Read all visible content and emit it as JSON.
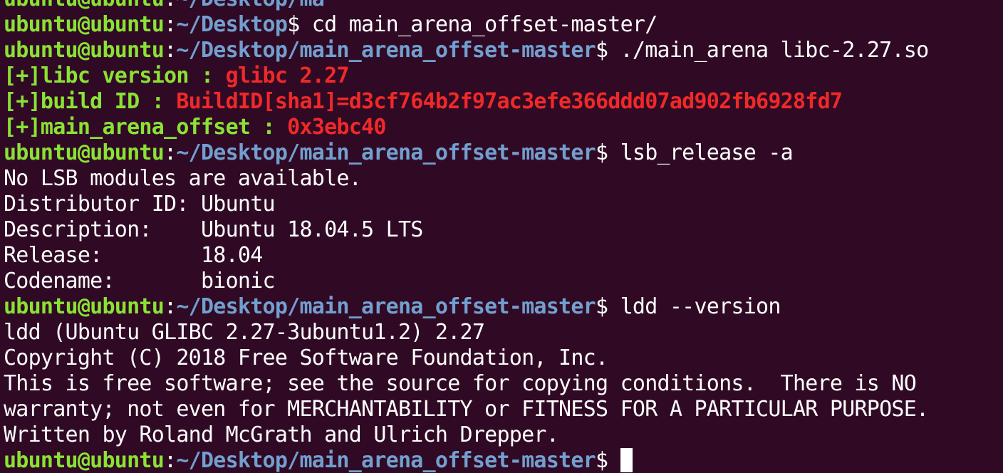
{
  "prompt": {
    "user_host": "ubuntu@ubuntu",
    "colon": ":",
    "dollar": "$"
  },
  "lines": {
    "l0": {
      "path": "~/Desktop/ma",
      "cmd": ""
    },
    "l1": {
      "path": "~/Desktop",
      "cmd": " cd main_arena_offset-master/"
    },
    "l2": {
      "path": "~/Desktop/main_arena_offset-master",
      "cmd": " ./main_arena libc-2.27.so"
    },
    "l3": {
      "label": "[+]libc version : ",
      "value": "glibc 2.27"
    },
    "l4": {
      "label": "[+]build ID : ",
      "value": "BuildID[sha1]=d3cf764b2f97ac3efe366ddd07ad902fb6928fd7"
    },
    "l5": {
      "label": "[+]main_arena_offset : ",
      "value": "0x3ebc40"
    },
    "l6": {
      "path": "~/Desktop/main_arena_offset-master",
      "cmd": " lsb_release -a"
    },
    "l7": "No LSB modules are available.",
    "l8": "Distributor ID:\tUbuntu",
    "l9": "Description:\tUbuntu 18.04.5 LTS",
    "l10": "Release:\t18.04",
    "l11": "Codename:\tbionic",
    "l12": {
      "path": "~/Desktop/main_arena_offset-master",
      "cmd": " ldd --version"
    },
    "l13": "ldd (Ubuntu GLIBC 2.27-3ubuntu1.2) 2.27",
    "l14": "Copyright (C) 2018 Free Software Foundation, Inc.",
    "l15": "This is free software; see the source for copying conditions.  There is NO",
    "l16": "warranty; not even for MERCHANTABILITY or FITNESS FOR A PARTICULAR PURPOSE.",
    "l17": "Written by Roland McGrath and Ulrich Drepper.",
    "l18": {
      "path": "~/Desktop/main_arena_offset-master",
      "cmd": " "
    }
  }
}
